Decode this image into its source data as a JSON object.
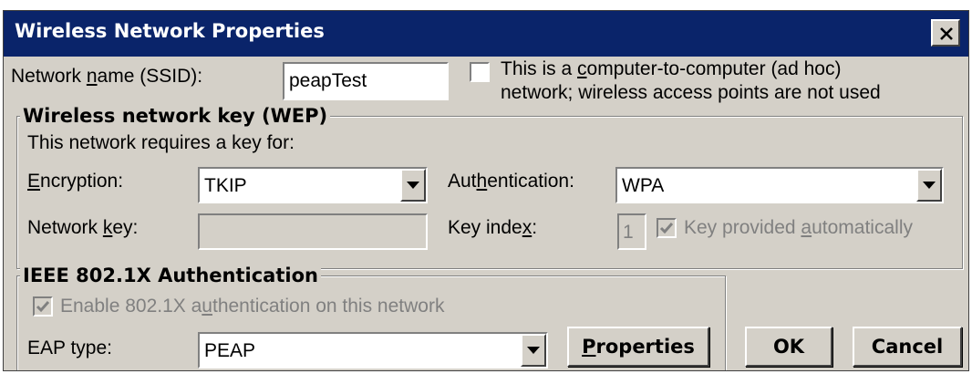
{
  "window": {
    "title": "Wireless Network Properties"
  },
  "ssid": {
    "label_pre": "Network ",
    "label_key": "n",
    "label_post": "ame (SSID):",
    "value": "peapTest"
  },
  "adhoc": {
    "checked": false,
    "line1_pre": "This is a ",
    "line1_key": "c",
    "line1_post": "omputer-to-computer (ad hoc)",
    "line2": "network; wireless access points are not used"
  },
  "wep_group": {
    "title": "Wireless network key (WEP)",
    "requires_label": "This network requires a key for:",
    "encryption": {
      "label_key": "E",
      "label_post": "ncryption:",
      "value": "TKIP"
    },
    "authentication": {
      "label_pre": "Aut",
      "label_key": "h",
      "label_post": "entication:",
      "value": "WPA"
    },
    "network_key": {
      "label_pre": "Network ",
      "label_key": "k",
      "label_post": "ey:",
      "value": ""
    },
    "key_index": {
      "label_pre": "Key inde",
      "label_key": "x",
      "label_post": ":",
      "value": "1"
    },
    "key_auto": {
      "checked": true,
      "label_pre": "Key provided ",
      "label_key": "a",
      "label_post": "utomatically"
    }
  },
  "ieee_group": {
    "title": "IEEE 802.1X Authentication",
    "enable": {
      "checked": true,
      "label_pre": "Enable 802.1X a",
      "label_key": "u",
      "label_post": "thentication on this network"
    },
    "eap": {
      "label": "EAP type:",
      "value": "PEAP"
    },
    "properties_button": {
      "label_key": "P",
      "label_post": "roperties"
    }
  },
  "buttons": {
    "ok": "OK",
    "cancel": "Cancel"
  }
}
